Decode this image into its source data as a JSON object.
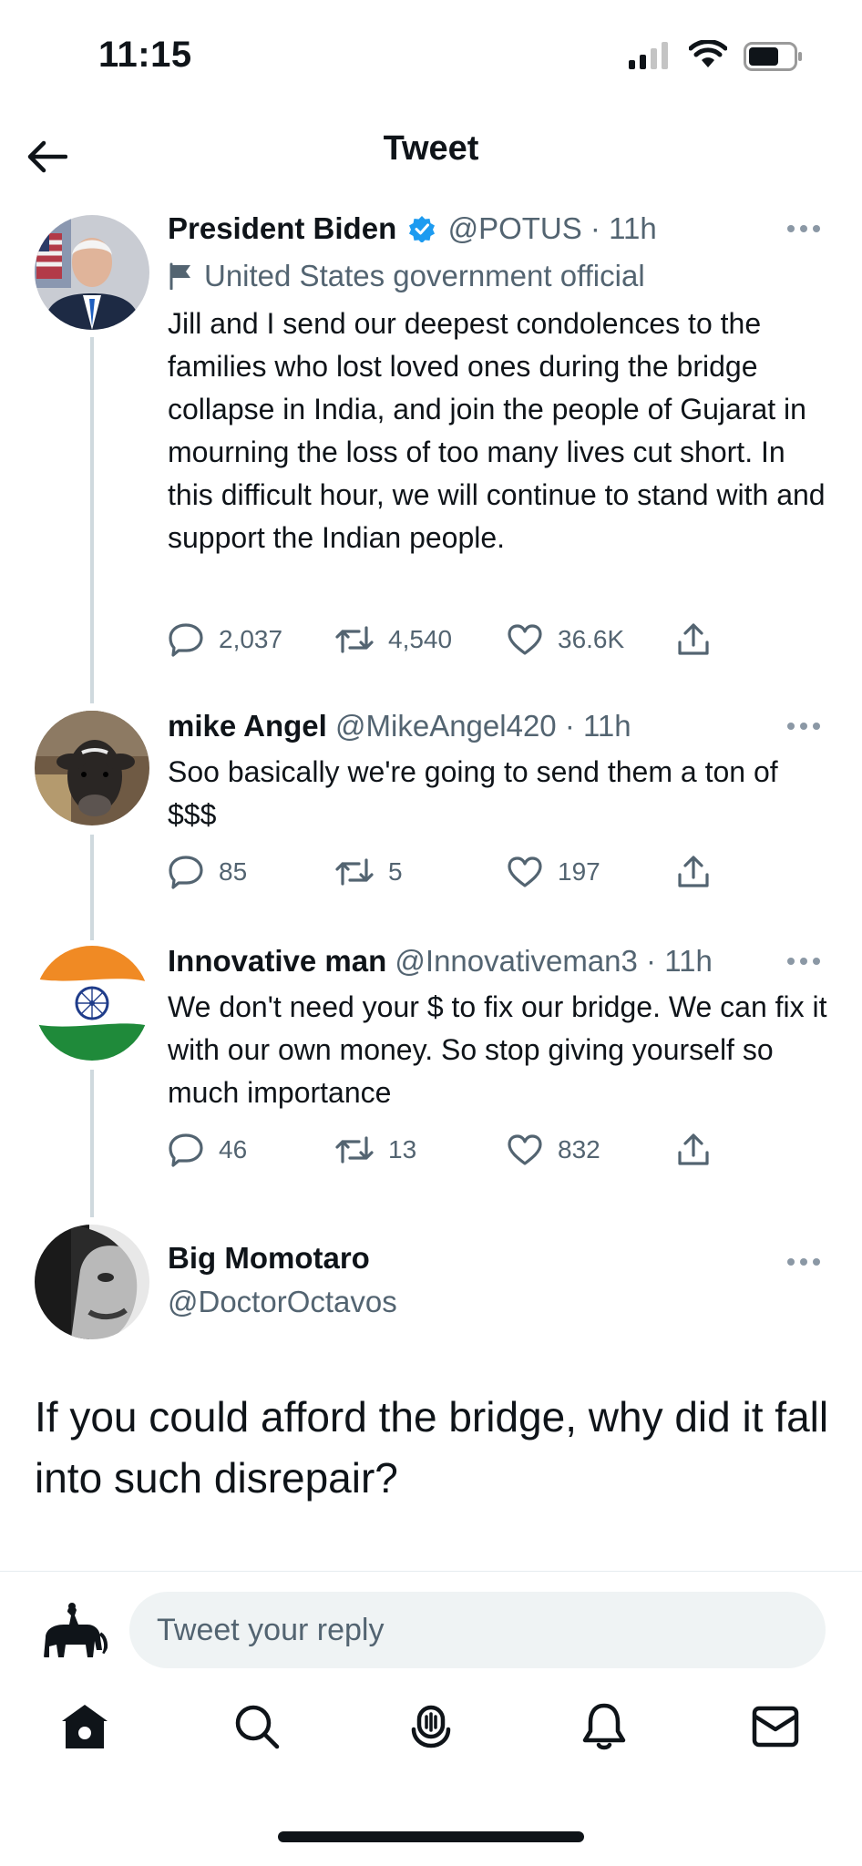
{
  "status_bar": {
    "time": "11:15"
  },
  "header": {
    "title": "Tweet"
  },
  "tweets": [
    {
      "name": "President Biden",
      "handle": "@POTUS · 11h",
      "label": "United States government official",
      "text": "Jill and I send our deepest condolences to the families who lost loved ones during the bridge collapse in India, and join the people of Gujarat in mourning the loss of too many lives cut short. In this difficult hour, we will continue to stand with and support the Indian people.",
      "replies": "2,037",
      "retweets": "4,540",
      "likes": "36.6K"
    },
    {
      "name": "mike Angel",
      "handle": "@MikeAngel420 · 11h",
      "text": "Soo basically we're going to send them a ton of $$$",
      "replies": "85",
      "retweets": "5",
      "likes": "197"
    },
    {
      "name": "Innovative man",
      "handle": "@Innovativeman3 · 11h",
      "text": "We don't need your $ to fix our bridge. We can fix it with our own money. So stop giving yourself so much importance",
      "replies": "46",
      "retweets": "13",
      "likes": "832"
    }
  ],
  "focused_tweet": {
    "name": "Big Momotaro",
    "handle": "@DoctorOctavos",
    "text": "If you could afford the bridge, why did it fall into such disrepair?"
  },
  "reply_bar": {
    "placeholder": "Tweet your reply"
  },
  "tab_bar": [
    "home-icon",
    "search-icon",
    "spaces-icon",
    "notifications-icon",
    "messages-icon"
  ],
  "colors": {
    "verified": "#1d9bf0",
    "text": "#0f1419",
    "secondary": "#536471",
    "thread_line": "#cfd9de"
  }
}
